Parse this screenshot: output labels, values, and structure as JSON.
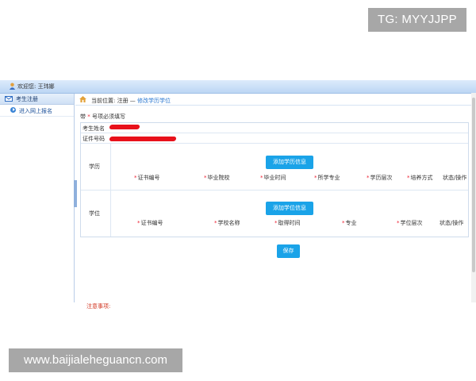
{
  "watermarks": {
    "top_right": "TG: MYYJJPP",
    "bottom_left": "www.baijialeheguancn.com"
  },
  "topbar": {
    "welcome": "欢迎您:  王玮娜"
  },
  "sidebar": {
    "header": "考生注册",
    "items": [
      {
        "label": "进入网上报名"
      }
    ]
  },
  "breadcrumb": {
    "prefix": "当前位置:  注册 — ",
    "current": "修改学历学位"
  },
  "form": {
    "required_note_prefix": "带 ",
    "required_star": "*",
    "required_note_suffix": " 号项必须填写",
    "name_label": "考生姓名",
    "id_label": "证件号码",
    "education": {
      "label": "学历",
      "add_button": "添加学历信息",
      "columns": [
        {
          "label": "证书编号",
          "required": true
        },
        {
          "label": "毕业院校",
          "required": true
        },
        {
          "label": "毕业时间",
          "required": true
        },
        {
          "label": "所学专业",
          "required": true
        },
        {
          "label": "学历层次",
          "required": true
        },
        {
          "label": "培养方式",
          "required": true
        },
        {
          "label": "状态/操作",
          "required": false
        }
      ]
    },
    "degree": {
      "label": "学位",
      "add_button": "添加学位信息",
      "columns": [
        {
          "label": "证书编号",
          "required": true
        },
        {
          "label": "学校名称",
          "required": true
        },
        {
          "label": "取得时间",
          "required": true
        },
        {
          "label": "专业",
          "required": true
        },
        {
          "label": "学位层次",
          "required": true
        },
        {
          "label": "状态/操作",
          "required": false
        }
      ]
    },
    "save_button": "保存",
    "notice": "注意事项:"
  },
  "colors": {
    "accent": "#1aa3e8",
    "required": "#e23333",
    "redaction": "#e8111b",
    "header_gradient": "#bcd6f4"
  }
}
